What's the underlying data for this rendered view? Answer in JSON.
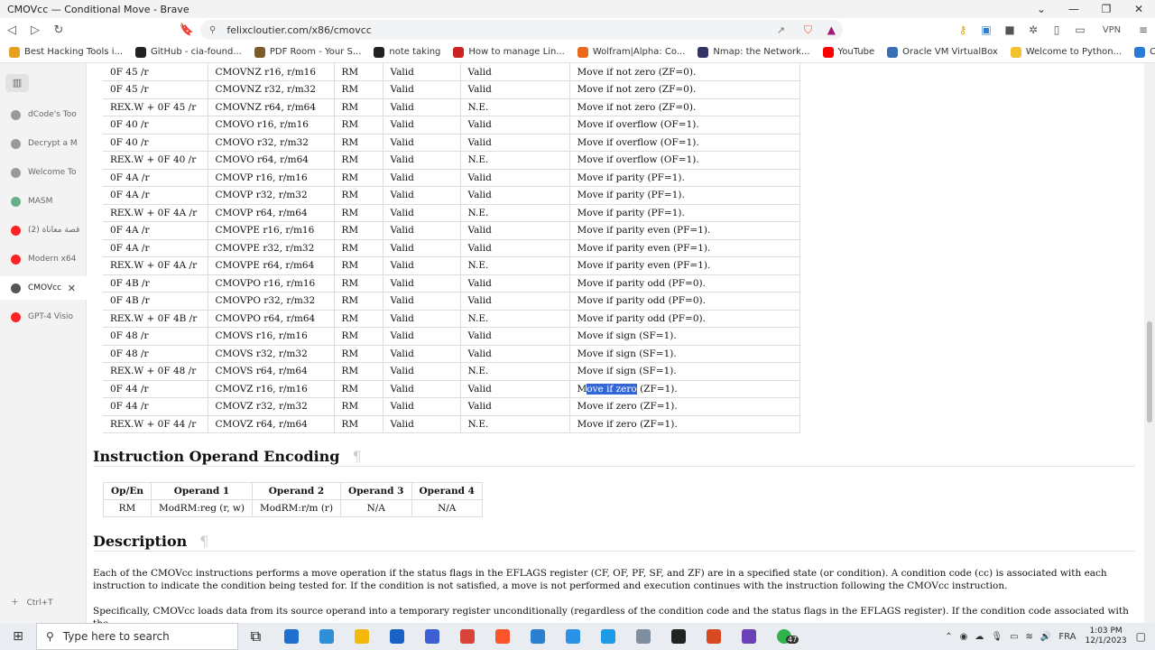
{
  "window": {
    "title": "CMOVcc — Conditional Move - Brave"
  },
  "address": {
    "url": "felixcloutier.com/x86/cmovcc",
    "vpn": "VPN"
  },
  "bookmarks": [
    {
      "label": "Best Hacking Tools i...",
      "color": "#e6a020"
    },
    {
      "label": "GitHub - cia-found...",
      "color": "#222222"
    },
    {
      "label": "PDF Room - Your S...",
      "color": "#7a5c2a"
    },
    {
      "label": "note taking",
      "color": "#222222"
    },
    {
      "label": "How to manage Lin...",
      "color": "#cc2222"
    },
    {
      "label": "Wolfram|Alpha: Co...",
      "color": "#e86a1a"
    },
    {
      "label": "Nmap: the Network...",
      "color": "#333366"
    },
    {
      "label": "YouTube",
      "color": "#ff0000"
    },
    {
      "label": "Oracle VM VirtualBox",
      "color": "#3a6fb5"
    },
    {
      "label": "Welcome to Python...",
      "color": "#f2c22e"
    },
    {
      "label": "Clearview AI | Facial...",
      "color": "#2b7bd6"
    }
  ],
  "sidebar": {
    "items": [
      {
        "label": "dCode's Too",
        "color": "#9a9a9a"
      },
      {
        "label": "Decrypt a M",
        "color": "#9a9a9a"
      },
      {
        "label": "Welcome To",
        "color": "#9a9a9a"
      },
      {
        "label": "MASM",
        "color": "#69b08a"
      },
      {
        "label": "(2) قصة معاناة",
        "color": "#ff2222"
      },
      {
        "label": "Modern x64",
        "color": "#ff2222"
      },
      {
        "label": "CMOVcc",
        "color": "#555555"
      },
      {
        "label": "GPT-4 Visio",
        "color": "#ff2222"
      }
    ],
    "new_tab": "Ctrl+T"
  },
  "opcodes": {
    "rows": [
      [
        "0F 45 /r",
        "CMOVNZ r16, r/m16",
        "RM",
        "Valid",
        "Valid",
        "Move if not zero (ZF=0)."
      ],
      [
        "0F 45 /r",
        "CMOVNZ r32, r/m32",
        "RM",
        "Valid",
        "Valid",
        "Move if not zero (ZF=0)."
      ],
      [
        "REX.W + 0F 45 /r",
        "CMOVNZ r64, r/m64",
        "RM",
        "Valid",
        "N.E.",
        "Move if not zero (ZF=0)."
      ],
      [
        "0F 40 /r",
        "CMOVO r16, r/m16",
        "RM",
        "Valid",
        "Valid",
        "Move if overflow (OF=1)."
      ],
      [
        "0F 40 /r",
        "CMOVO r32, r/m32",
        "RM",
        "Valid",
        "Valid",
        "Move if overflow (OF=1)."
      ],
      [
        "REX.W + 0F 40 /r",
        "CMOVO r64, r/m64",
        "RM",
        "Valid",
        "N.E.",
        "Move if overflow (OF=1)."
      ],
      [
        "0F 4A /r",
        "CMOVP r16, r/m16",
        "RM",
        "Valid",
        "Valid",
        "Move if parity (PF=1)."
      ],
      [
        "0F 4A /r",
        "CMOVP r32, r/m32",
        "RM",
        "Valid",
        "Valid",
        "Move if parity (PF=1)."
      ],
      [
        "REX.W + 0F 4A /r",
        "CMOVP r64, r/m64",
        "RM",
        "Valid",
        "N.E.",
        "Move if parity (PF=1)."
      ],
      [
        "0F 4A /r",
        "CMOVPE r16, r/m16",
        "RM",
        "Valid",
        "Valid",
        "Move if parity even (PF=1)."
      ],
      [
        "0F 4A /r",
        "CMOVPE r32, r/m32",
        "RM",
        "Valid",
        "Valid",
        "Move if parity even (PF=1)."
      ],
      [
        "REX.W + 0F 4A /r",
        "CMOVPE r64, r/m64",
        "RM",
        "Valid",
        "N.E.",
        "Move if parity even (PF=1)."
      ],
      [
        "0F 4B /r",
        "CMOVPO r16, r/m16",
        "RM",
        "Valid",
        "Valid",
        "Move if parity odd (PF=0)."
      ],
      [
        "0F 4B /r",
        "CMOVPO r32, r/m32",
        "RM",
        "Valid",
        "Valid",
        "Move if parity odd (PF=0)."
      ],
      [
        "REX.W + 0F 4B /r",
        "CMOVPO r64, r/m64",
        "RM",
        "Valid",
        "N.E.",
        "Move if parity odd (PF=0)."
      ],
      [
        "0F 48 /r",
        "CMOVS r16, r/m16",
        "RM",
        "Valid",
        "Valid",
        "Move if sign (SF=1)."
      ],
      [
        "0F 48 /r",
        "CMOVS r32, r/m32",
        "RM",
        "Valid",
        "Valid",
        "Move if sign (SF=1)."
      ],
      [
        "REX.W + 0F 48 /r",
        "CMOVS r64, r/m64",
        "RM",
        "Valid",
        "N.E.",
        "Move if sign (SF=1)."
      ],
      [
        "0F 44 /r",
        "CMOVZ r16, r/m16",
        "RM",
        "Valid",
        "Valid",
        "Move if zero (ZF=1)."
      ],
      [
        "0F 44 /r",
        "CMOVZ r32, r/m32",
        "RM",
        "Valid",
        "Valid",
        "Move if zero (ZF=1)."
      ],
      [
        "REX.W + 0F 44 /r",
        "CMOVZ r64, r/m64",
        "RM",
        "Valid",
        "N.E.",
        "Move if zero (ZF=1)."
      ]
    ],
    "highlight": {
      "row": 18,
      "before": "M",
      "selected": "ove if zero",
      "after": " (ZF=1)."
    }
  },
  "encoding": {
    "heading": "Instruction Operand Encoding",
    "pilcrow": "¶",
    "headers": [
      "Op/En",
      "Operand 1",
      "Operand 2",
      "Operand 3",
      "Operand 4"
    ],
    "row": [
      "RM",
      "ModRM:reg (r, w)",
      "ModRM:r/m (r)",
      "N/A",
      "N/A"
    ]
  },
  "description": {
    "heading": "Description",
    "pilcrow": "¶",
    "p1": "Each of the CMOVcc instructions performs a move operation if the status flags in the EFLAGS register (CF, OF, PF, SF, and ZF) are in a specified state (or condition). A condition code (cc) is associated with each instruction to indicate the condition being tested for. If the condition is not satisfied, a move is not performed and execution continues with the instruction following the CMOVcc instruction.",
    "p2": "Specifically, CMOVcc loads data from its source operand into a temporary register unconditionally (regardless of the condition code and the status flags in the EFLAGS register). If the condition code associated with the"
  },
  "taskbar": {
    "search_placeholder": "Type here to search",
    "language": "FRA",
    "time": "1:03 PM",
    "date": "12/1/2023",
    "apps": [
      "#1f6fd1",
      "#2e8fd8",
      "#f2b90c",
      "#1a63c6",
      "#3c5fd3",
      "#d8443a",
      "#fb542b",
      "#2a7fd1",
      "#2a93e6",
      "#1e9be8",
      "#7f8fa0",
      "#222222",
      "#d94a22",
      "#6b3fb5",
      "#2fb34a"
    ],
    "badge": "47"
  }
}
